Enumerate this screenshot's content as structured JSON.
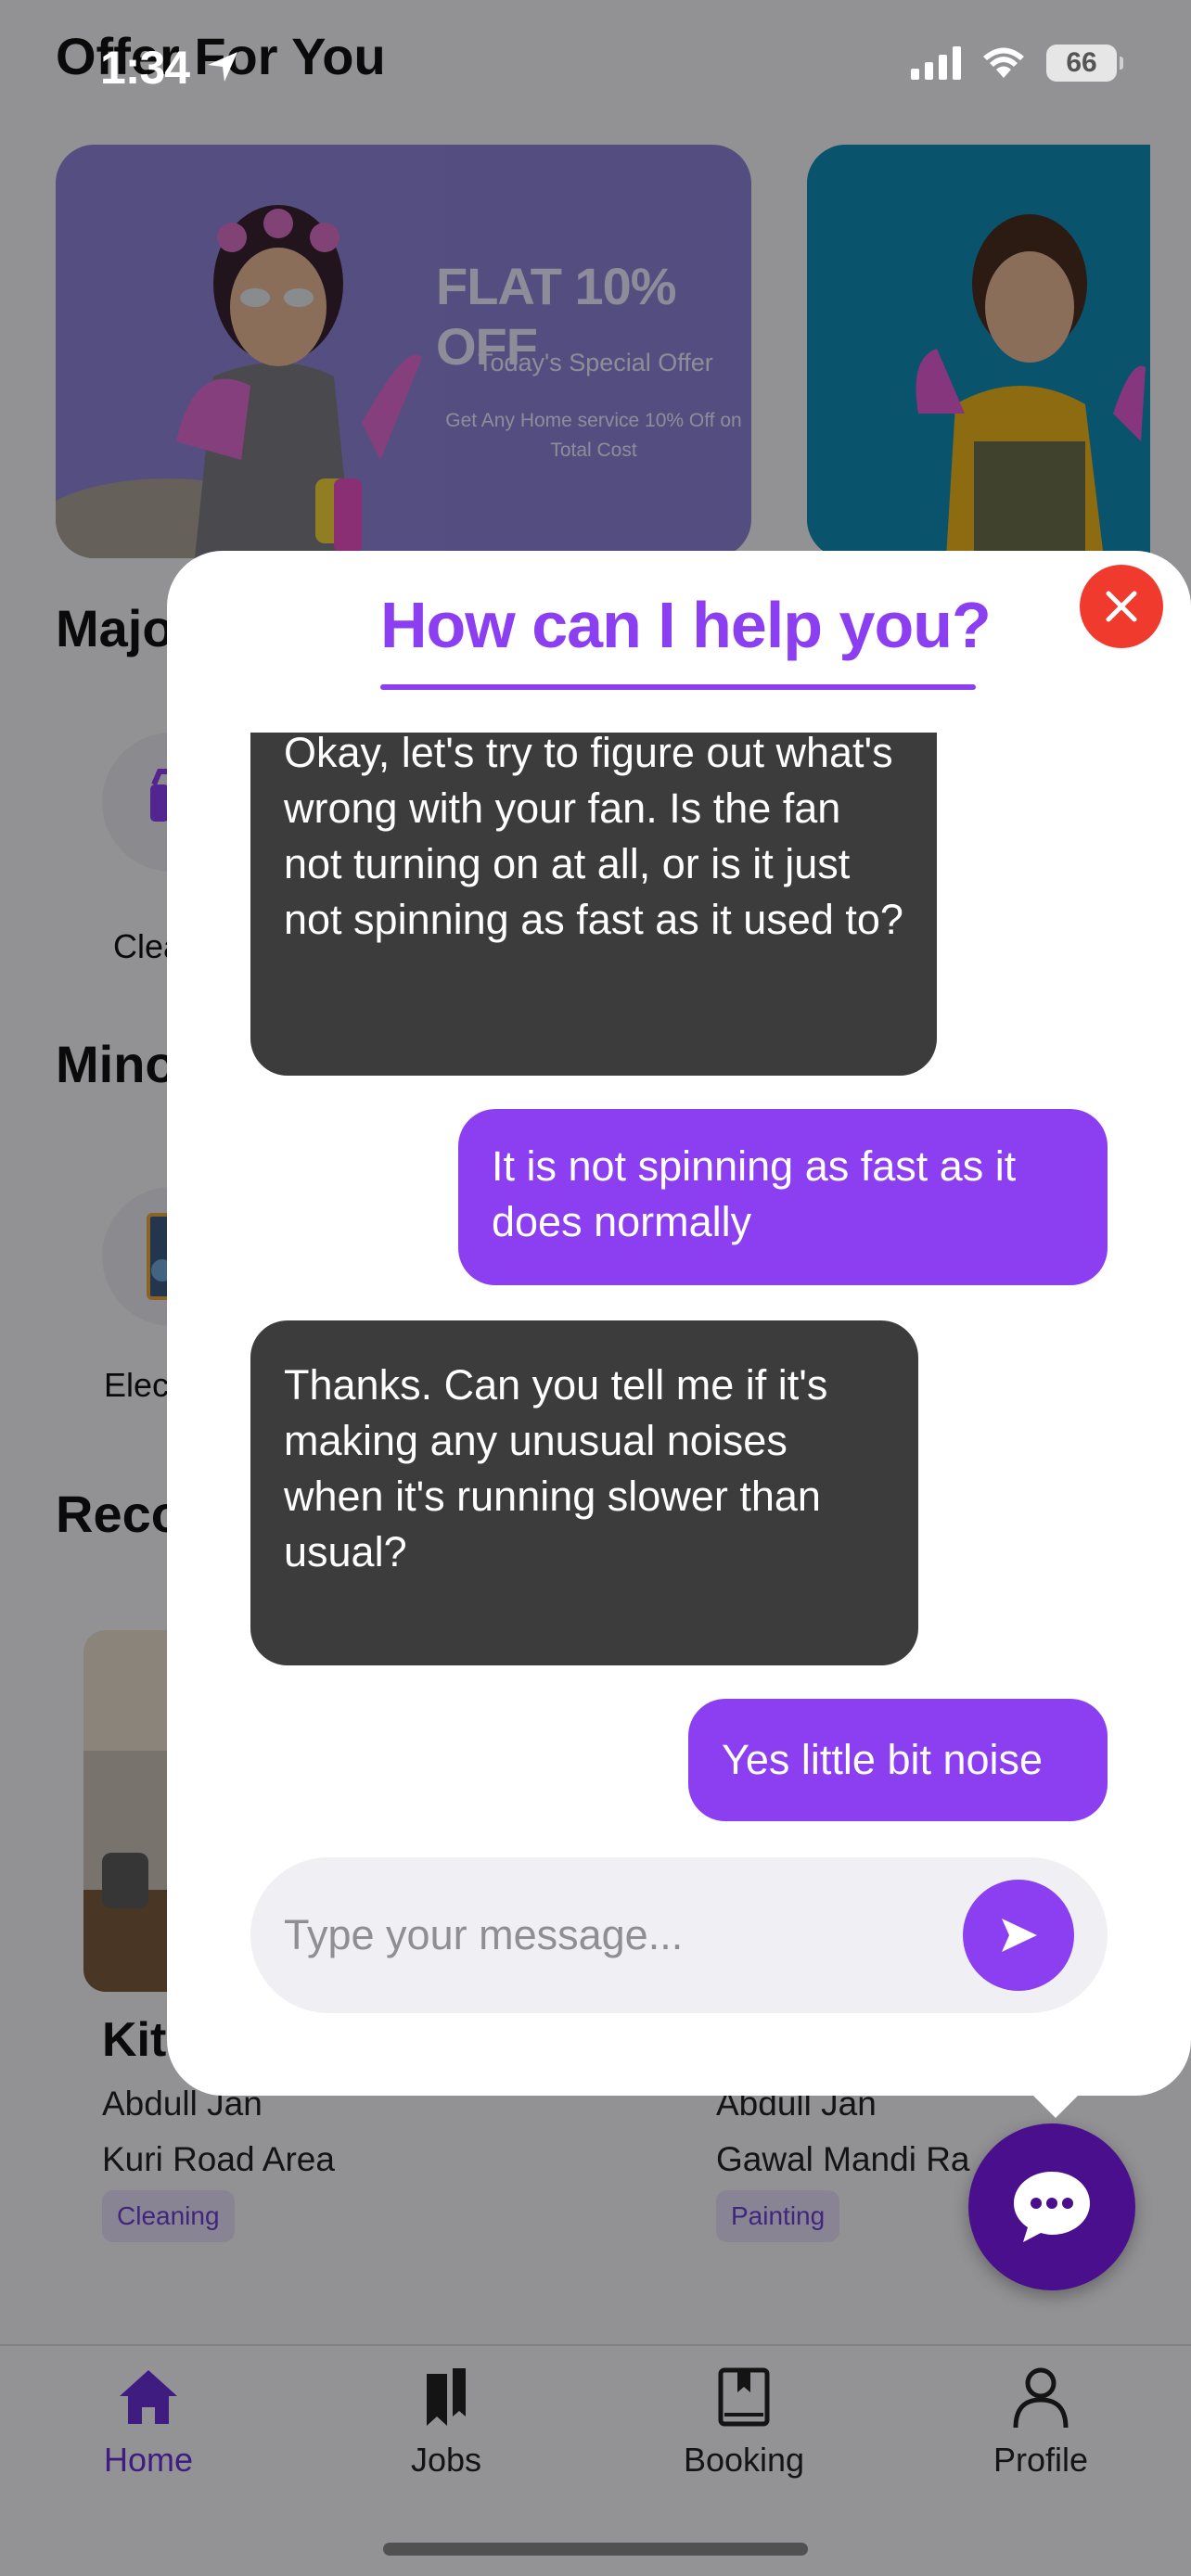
{
  "status_bar": {
    "time": "1:34",
    "battery": "66"
  },
  "offers": {
    "section_title": "Offer For You",
    "card1": {
      "title": "FLAT 10% OFF",
      "subtitle": "Today's Special Offer",
      "description": "Get Any Home service 10% Off on Total Cost"
    }
  },
  "sections": {
    "major": "Major",
    "minor": "Minor",
    "recommended": "Recommended"
  },
  "categories": {
    "major_first": "Cleaning",
    "minor_first": "Electrician"
  },
  "recommended": [
    {
      "title": "Kitchen",
      "provider": "Abdull Jan",
      "location": "Kuri Road Area",
      "tag": "Cleaning"
    },
    {
      "provider": "Abdull Jan",
      "location": "Gawal Mandi Ra",
      "tag": "Painting"
    }
  ],
  "tabs": [
    {
      "label": "Home",
      "icon": "home-icon",
      "active": true
    },
    {
      "label": "Jobs",
      "icon": "bookmarks-icon",
      "active": false
    },
    {
      "label": "Booking",
      "icon": "book-icon",
      "active": false
    },
    {
      "label": "Profile",
      "icon": "person-icon",
      "active": false
    }
  ],
  "chat": {
    "title": "How can I help you?",
    "messages": [
      {
        "from": "bot",
        "text": "Okay, let's try to figure out what's wrong with your fan. Is the fan not turning on at all, or is it just not spinning as fast as it used to?"
      },
      {
        "from": "user",
        "text": "It is not spinning as fast as it does normally"
      },
      {
        "from": "bot",
        "text": "Thanks. Can you tell me if it's making any unusual noises when it's running slower than usual?"
      },
      {
        "from": "user",
        "text": "Yes little bit noise"
      }
    ],
    "input_placeholder": "Type your message..."
  },
  "colors": {
    "accent": "#8b3ff0",
    "fab": "#4a0f8c",
    "close": "#f03a2e",
    "bot_bubble": "#3c3c3c"
  }
}
